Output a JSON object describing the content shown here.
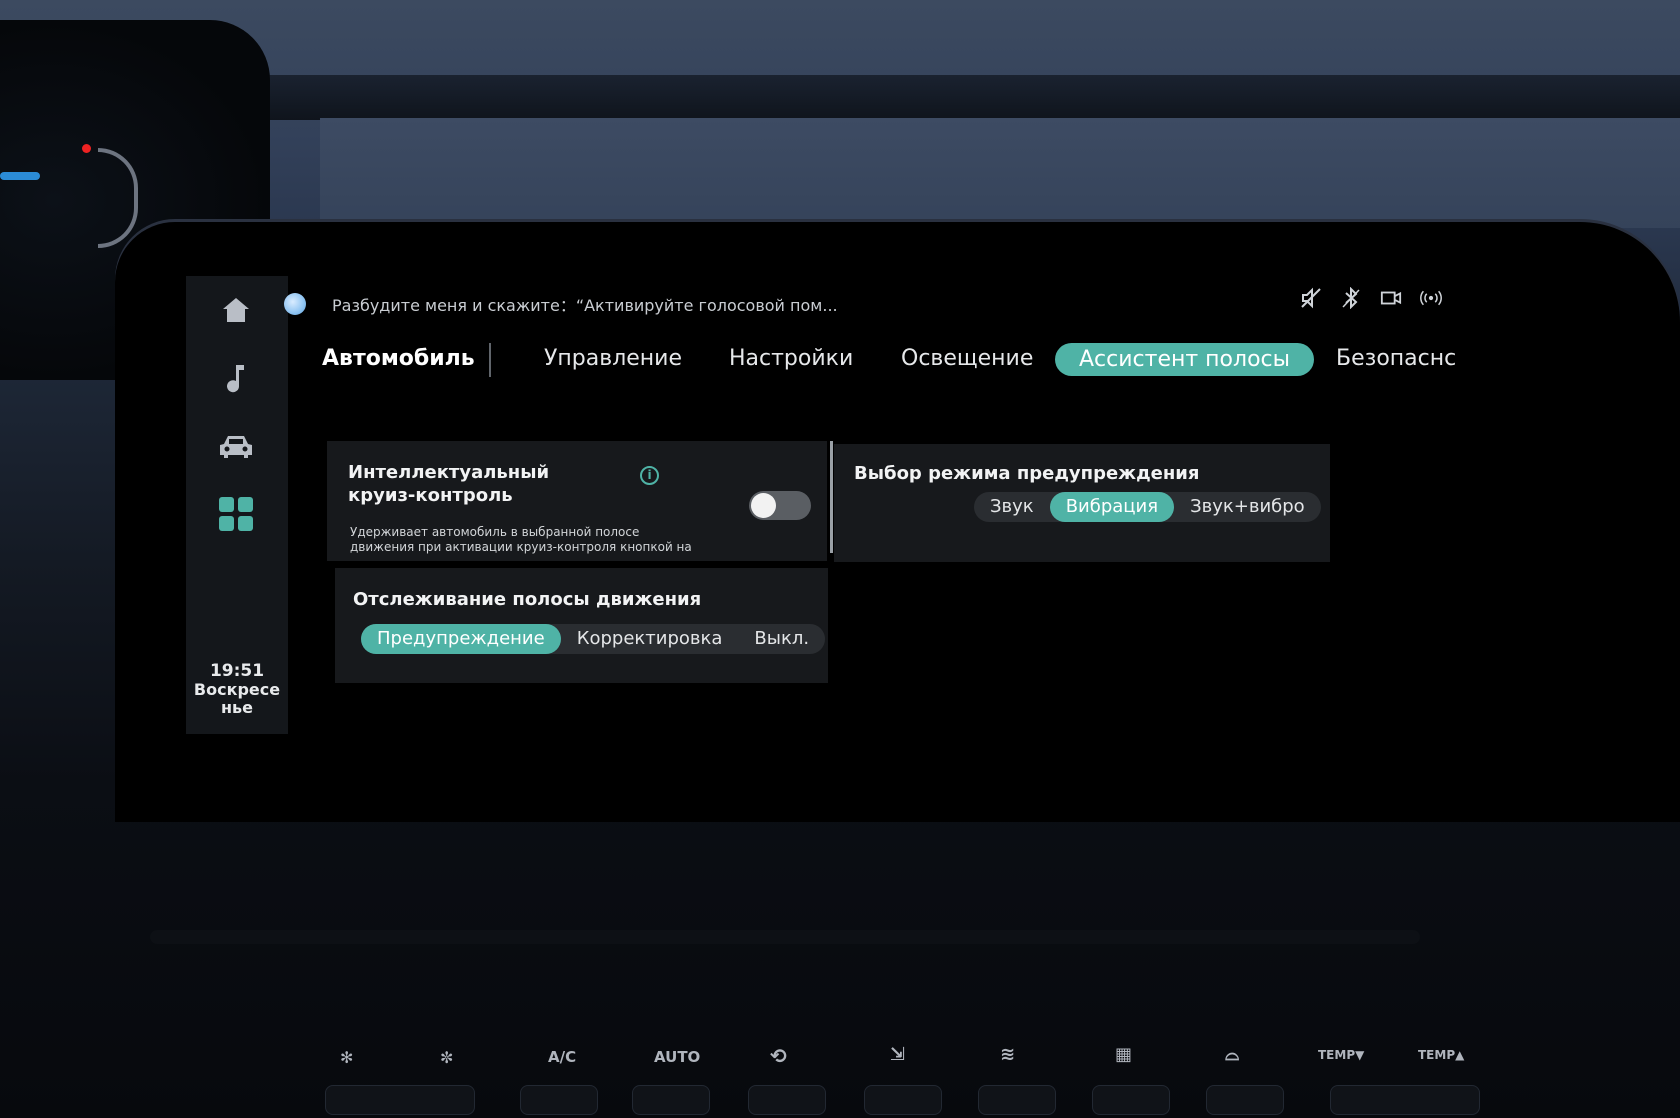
{
  "voice_assistant": {
    "prompt": "Разбудите меня и скажите：“Активируйте голосовой пом..."
  },
  "status_icons": [
    "mute-speaker-icon",
    "bluetooth-off-icon",
    "camera-icon",
    "signal-broadcast-icon"
  ],
  "sidebar": {
    "items": [
      {
        "icon": "home-icon"
      },
      {
        "icon": "music-note-icon"
      },
      {
        "icon": "car-icon"
      },
      {
        "icon": "apps-grid-icon"
      }
    ],
    "time": "19:51",
    "day_line1": "Воскресе",
    "day_line2": "нье"
  },
  "tabs": {
    "main": "Автомобиль",
    "items": [
      "Управление",
      "Настройки",
      "Освещение",
      "Ассистент полосы",
      "Безопаснс"
    ],
    "active_index": 3
  },
  "cruise_card": {
    "title_line1": "Интеллектуальный",
    "title_line2": "круиз-контроль",
    "description_line1": "Удерживает автомобиль в выбранной полосе",
    "description_line2": "движения при активации круиз-контроля кнопкой на",
    "toggle_on": false
  },
  "warning_mode_card": {
    "title": "Выбор режима предупреждения",
    "options": [
      "Звук",
      "Вибрация",
      "Звук+вибро"
    ],
    "selected": "Вибрация"
  },
  "lane_tracking_card": {
    "title": "Отслеживание полосы движения",
    "options": [
      "Предупреждение",
      "Корректировка",
      "Выкл."
    ],
    "selected": "Предупреждение"
  },
  "climate_controls": [
    "A/C",
    "AUTO",
    "TEMP▼",
    "TEMP▲"
  ],
  "colors": {
    "accent": "#4fb3a6",
    "card_bg": "#17191c",
    "rail_bg": "#14171b"
  }
}
